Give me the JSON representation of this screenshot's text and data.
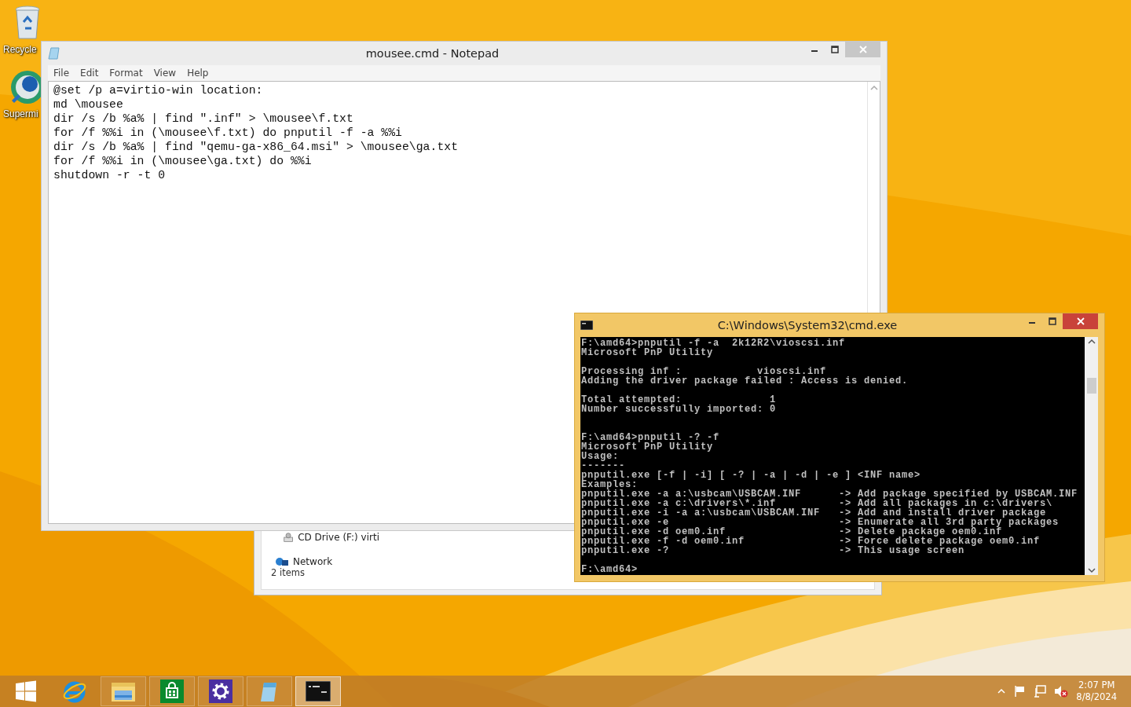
{
  "desktop": {
    "icons": [
      {
        "kind": "recycle-bin",
        "label": "Recycle"
      },
      {
        "kind": "globe",
        "label": "Supermi"
      }
    ]
  },
  "notepad": {
    "title": "mousee.cmd - Notepad",
    "menu": [
      "File",
      "Edit",
      "Format",
      "View",
      "Help"
    ],
    "lines": [
      "@set /p a=virtio-win location:",
      "md \\mousee",
      "dir /s /b %a% | find \".inf\" > \\mousee\\f.txt",
      "for /f %%i in (\\mousee\\f.txt) do pnputil -f -a %%i",
      "dir /s /b %a% | find \"qemu-ga-x86_64.msi\" > \\mousee\\ga.txt",
      "for /f %%i in (\\mousee\\ga.txt) do %%i",
      "shutdown -r -t 0"
    ]
  },
  "explorer": {
    "nav_items": [
      {
        "kind": "cd-drive",
        "label": "CD Drive (F:) virti"
      },
      {
        "kind": "network",
        "label": "Network"
      }
    ],
    "status": "2 items"
  },
  "cmd": {
    "title": "C:\\Windows\\System32\\cmd.exe",
    "sessions": [
      {
        "paragraphs": [
          [
            "F:\\amd64>pnputil -f -a  2k12R2\\vioscsi.inf",
            "Microsoft PnP Utility"
          ],
          [
            "Processing inf :            vioscsi.inf",
            "Adding the driver package failed : Access is denied."
          ],
          [
            "Total attempted:              1",
            "Number successfully imported: 0"
          ]
        ]
      },
      {
        "paragraphs": [
          [
            "F:\\amd64>pnputil -? -f",
            "Microsoft PnP Utility",
            "Usage:",
            "-------",
            "pnputil.exe [-f | -i] [ -? | -a | -d | -e ] <INF name>",
            "Examples:",
            "pnputil.exe -a a:\\usbcam\\USBCAM.INF      -> Add package specified by USBCAM.INF",
            "pnputil.exe -a c:\\drivers\\*.inf          -> Add all packages in c:\\drivers\\",
            "pnputil.exe -i -a a:\\usbcam\\USBCAM.INF   -> Add and install driver package",
            "pnputil.exe -e                           -> Enumerate all 3rd party packages",
            "pnputil.exe -d oem0.inf                  -> Delete package oem0.inf",
            "pnputil.exe -f -d oem0.inf               -> Force delete package oem0.inf",
            "pnputil.exe -?                           -> This usage screen"
          ],
          [
            "F:\\amd64>"
          ]
        ]
      }
    ]
  },
  "taskbar": {
    "buttons": [
      {
        "kind": "start",
        "selected": false
      },
      {
        "kind": "browser",
        "selected": false
      },
      {
        "kind": "file-explorer",
        "selected": false
      },
      {
        "kind": "store",
        "selected": false
      },
      {
        "kind": "settings",
        "selected": false
      },
      {
        "kind": "notepad",
        "selected": false
      },
      {
        "kind": "console",
        "selected": true
      }
    ],
    "clock": {
      "time": "2:07 PM",
      "date": "8/8/2024"
    }
  }
}
